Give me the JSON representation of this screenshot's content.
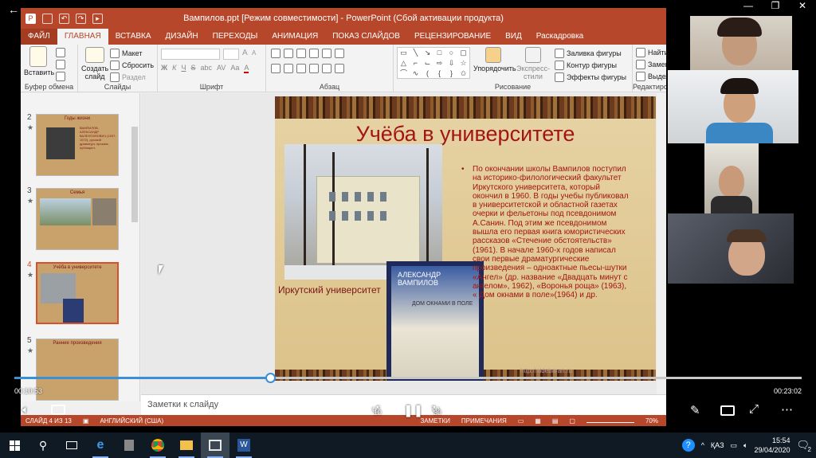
{
  "window": {
    "title": "Вампилов.ppt [Режим совместимости] - PowerPoint (Сбой активации продукта)"
  },
  "ribbon": {
    "tabs": [
      "ФАЙЛ",
      "ГЛАВНАЯ",
      "ВСТАВКА",
      "ДИЗАЙН",
      "ПЕРЕХОДЫ",
      "АНИМАЦИЯ",
      "ПОКАЗ СЛАЙДОВ",
      "РЕЦЕНЗИРОВАНИЕ",
      "ВИД",
      "Раскадровка"
    ],
    "active_tab": "ГЛАВНАЯ",
    "clipboard": {
      "paste": "Вставить",
      "label": "Буфер обмена"
    },
    "slides": {
      "new_slide": "Создать слайд",
      "layout": "Макет",
      "reset": "Сбросить",
      "section": "Раздел",
      "label": "Слайды"
    },
    "font": {
      "label": "Шрифт",
      "bold": "Ж",
      "italic": "К",
      "underline": "Ч",
      "strike": "S",
      "shadow": "abc",
      "spacing": "AV",
      "case": "Aa",
      "size_up": "A",
      "size_down": "A",
      "color": "A"
    },
    "paragraph": {
      "label": "Абзац"
    },
    "drawing": {
      "arrange": "Упорядочить",
      "quick_styles": "Экспресс-стили",
      "fill": "Заливка фигуры",
      "outline": "Контур фигуры",
      "effects": "Эффекты фигуры",
      "label": "Рисование"
    },
    "editing": {
      "find": "Найти",
      "replace": "Заменить",
      "select": "Выделить",
      "label": "Редактиров..."
    }
  },
  "thumbnails": [
    {
      "num": "2",
      "title": "Годы жизни",
      "text": "ВАМПИЛОВ, АЛЕКСАНДР ВАЛЕНТИНОВИЧ (1937-1972), русский драматург, прозаик, публицист."
    },
    {
      "num": "3",
      "title": "Семья",
      "text": ""
    },
    {
      "num": "4",
      "title": "Учёба в университете",
      "text": ""
    },
    {
      "num": "5",
      "title": "Ранние произведения",
      "text": ""
    }
  ],
  "thumb_star": "★",
  "slide": {
    "title": "Учёба в университете",
    "photo_caption": "Иркутский университет",
    "book_author": "АЛЕКСАНДР ВАМПИЛОВ",
    "book_title": "ДОМ ОКНАМИ В ПОЛЕ",
    "bullet": "•",
    "body": "По окончании школы Вампилов поступил на историко-филологический факультет Иркутского университета, который окончил в 1960. В годы учебы публиковал в университетской и областной газетах очерки и фельетоны под псевдонимом А.Санин. Под этим же псевдонимом вышла его первая книга юмористических рассказов «Стечение обстоятельств» (1961). В начале 1960-х годов написал свои первые драматургические произведения – одноактные пьесы-шутки «Ангел» (др. название «Двадцать минут с ангелом», 1962), «Воронья роща» (1963), « Дом окнами в поле»(1964) и др.",
    "watermark": "http://aldebaran.ru"
  },
  "notes": {
    "placeholder": "Заметки к слайду"
  },
  "status": {
    "slide": "СЛАЙД 4 ИЗ 13",
    "lang": "АНГЛИЙСКИЙ (США)",
    "notes": "ЗАМЕТКИ",
    "comments": "ПРИМЕЧАНИЯ",
    "zoom": "70%"
  },
  "video": {
    "elapsed": "00:10:53",
    "total": "00:23:02",
    "progress": 0.325,
    "skip_back": "10",
    "skip_fwd": "30"
  },
  "taskbar": {
    "lang": "ҚАЗ",
    "time": "15:54",
    "date": "29/04/2020",
    "notif": "2"
  }
}
